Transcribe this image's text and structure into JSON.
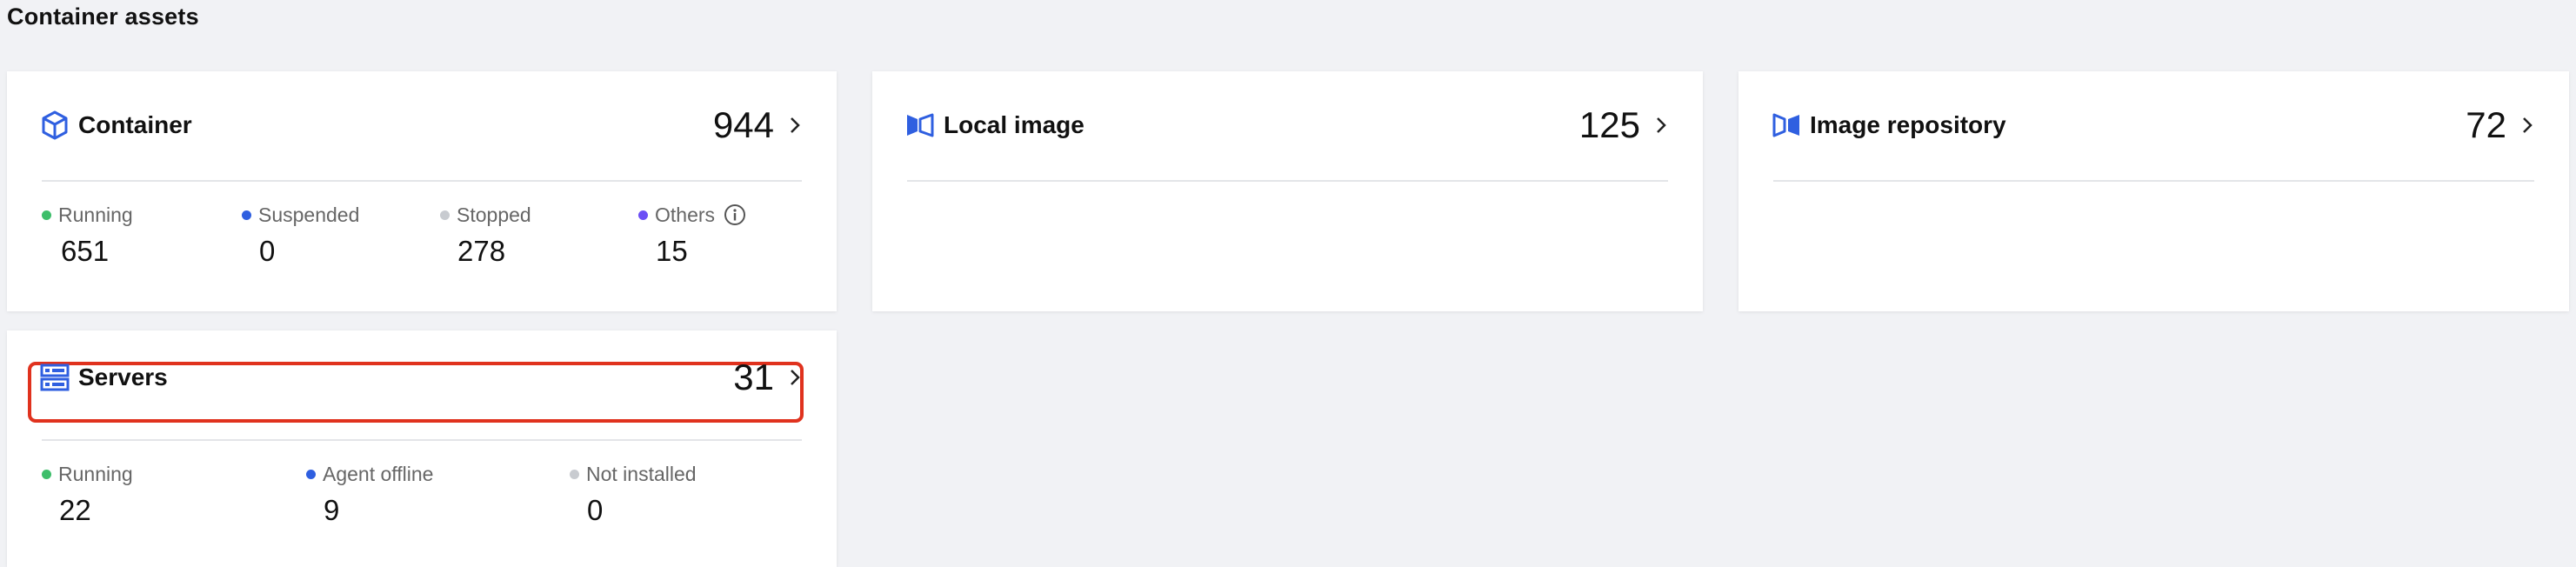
{
  "section_title": "Container assets",
  "colors": {
    "accent_blue": "#2f5fe0",
    "running_green": "#3dbe6a",
    "suspended_blue": "#2f5fe0",
    "stopped_gray": "#c8cbd0",
    "others_purple": "#6b4ef5",
    "highlight_red": "#e0321e"
  },
  "cards": {
    "container": {
      "icon": "cube-icon",
      "title": "Container",
      "count": "944",
      "stats": [
        {
          "label": "Running",
          "value": "651",
          "dot": "#3dbe6a"
        },
        {
          "label": "Suspended",
          "value": "0",
          "dot": "#2f5fe0"
        },
        {
          "label": "Stopped",
          "value": "278",
          "dot": "#c8cbd0"
        },
        {
          "label": "Others",
          "value": "15",
          "dot": "#6b4ef5"
        }
      ]
    },
    "local_image": {
      "icon": "image-layers-icon",
      "title": "Local image",
      "count": "125"
    },
    "image_repository": {
      "icon": "image-layers-icon",
      "title": "Image repository",
      "count": "72"
    },
    "servers": {
      "icon": "server-icon",
      "title": "Servers",
      "count": "31",
      "stats": [
        {
          "label": "Running",
          "value": "22",
          "dot": "#3dbe6a"
        },
        {
          "label": "Agent offline",
          "value": "9",
          "dot": "#2f5fe0"
        },
        {
          "label": "Not installed",
          "value": "0",
          "dot": "#c8cbd0"
        }
      ]
    }
  }
}
